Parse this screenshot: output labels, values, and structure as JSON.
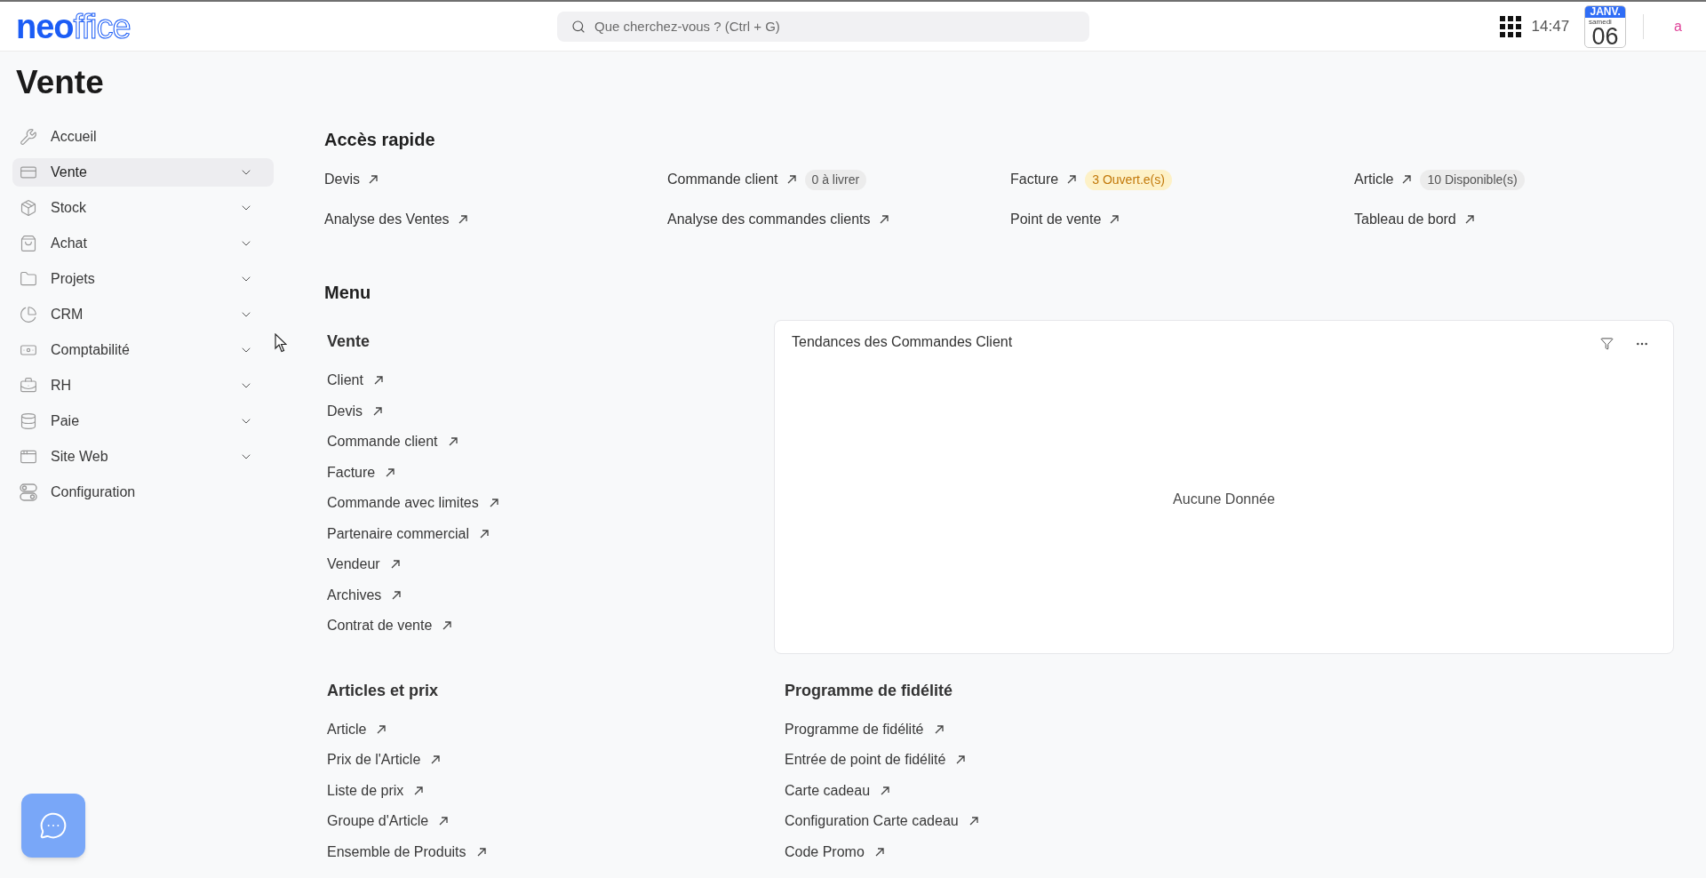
{
  "top_bar": {
    "logo": {
      "solid": "neo",
      "outlined": "ffice"
    },
    "search": {
      "placeholder": "Que cherchez-vous ? (Ctrl + G)"
    },
    "time": "14:47",
    "calendar": {
      "month": "JANV.",
      "weekday": "samedi",
      "day": "06"
    },
    "user_initial": "a"
  },
  "page_title": "Vente",
  "sidebar": {
    "items": [
      {
        "label": "Accueil",
        "selected": false,
        "expandable": false
      },
      {
        "label": "Vente",
        "selected": true,
        "expandable": true
      },
      {
        "label": "Stock",
        "selected": false,
        "expandable": true
      },
      {
        "label": "Achat",
        "selected": false,
        "expandable": true
      },
      {
        "label": "Projets",
        "selected": false,
        "expandable": true
      },
      {
        "label": "CRM",
        "selected": false,
        "expandable": true
      },
      {
        "label": "Comptabilité",
        "selected": false,
        "expandable": true
      },
      {
        "label": "RH",
        "selected": false,
        "expandable": true
      },
      {
        "label": "Paie",
        "selected": false,
        "expandable": true
      },
      {
        "label": "Site Web",
        "selected": false,
        "expandable": true
      },
      {
        "label": "Configuration",
        "selected": false,
        "expandable": false
      }
    ]
  },
  "quick_access": {
    "title": "Accès rapide",
    "links": [
      {
        "label": "Devis"
      },
      {
        "label": "Commande client",
        "badge": {
          "text": "0 à livrer",
          "kind": "neutral"
        }
      },
      {
        "label": "Facture",
        "badge": {
          "text": "3 Ouvert.e(s)",
          "kind": "warning"
        }
      },
      {
        "label": "Article",
        "badge": {
          "text": "10 Disponible(s)",
          "kind": "neutral"
        }
      },
      {
        "label": "Analyse des Ventes"
      },
      {
        "label": "Analyse des commandes clients"
      },
      {
        "label": "Point de vente"
      },
      {
        "label": "Tableau de bord"
      }
    ]
  },
  "menu": {
    "title": "Menu",
    "cards": [
      {
        "kind": "links",
        "title": "Vente",
        "links": [
          "Client",
          "Devis",
          "Commande client",
          "Facture",
          "Commande avec limites",
          "Partenaire commercial",
          "Vendeur",
          "Archives",
          "Contrat de vente"
        ]
      },
      {
        "kind": "chart",
        "title": "Tendances des Commandes Client",
        "empty_message": "Aucune Donnée"
      },
      {
        "kind": "links",
        "title": "Articles et prix",
        "links": [
          "Article",
          "Prix de l'Article",
          "Liste de prix",
          "Groupe d'Article",
          "Ensemble de Produits"
        ]
      },
      {
        "kind": "links",
        "title": "Programme de fidélité",
        "links": [
          "Programme de fidélité",
          "Entrée de point de fidélité",
          "Carte cadeau",
          "Configuration Carte cadeau",
          "Code Promo"
        ]
      }
    ]
  }
}
